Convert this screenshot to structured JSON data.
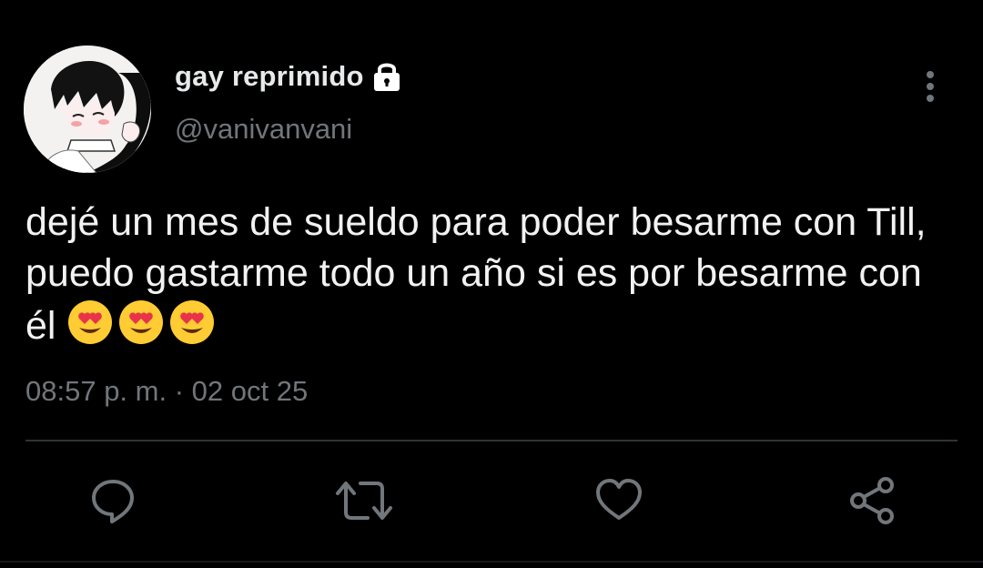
{
  "user": {
    "display_name": "gay reprimido",
    "handle": "@vanivanvani",
    "avatar": "anime-character-avatar",
    "locked_icon": "lock-icon"
  },
  "tweet": {
    "line1": "dejé un mes de sueldo para poder besarme con Till,",
    "line2": "puedo gastarme todo un año si es por besarme con",
    "line3": "él",
    "emojis": [
      "😍",
      "😍",
      "😍"
    ],
    "timestamp": "08:57 p. m. · 02 oct 25"
  },
  "icons": {
    "more": "more-vertical-icon",
    "reply": "reply-icon",
    "retweet": "retweet-icon",
    "like": "heart-icon",
    "share": "share-icon"
  },
  "colors": {
    "background": "#000000",
    "text": "#e7e9ea",
    "secondary": "#71767b",
    "divider": "#2f3336",
    "emoji_face": "#ffcc33",
    "emoji_heart": "#e8334a"
  }
}
